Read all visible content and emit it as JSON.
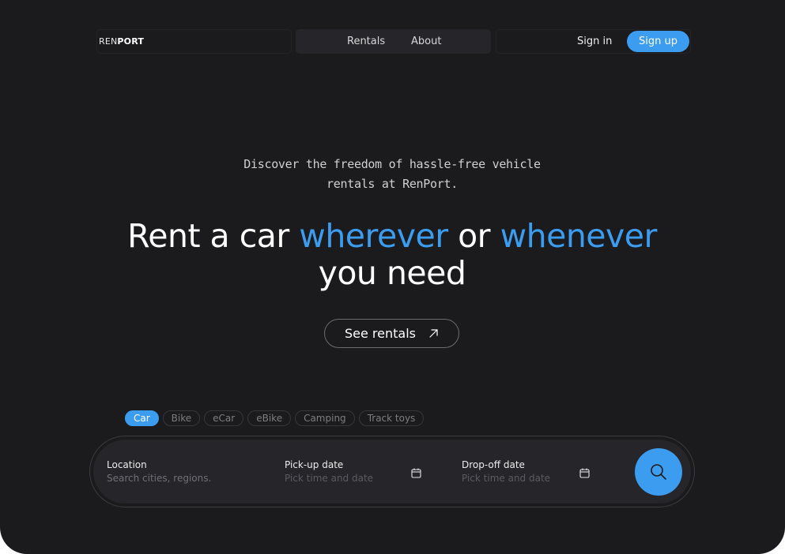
{
  "nav": {
    "logo_prefix": "REN",
    "logo_suffix": "PORT",
    "links": [
      "Rentals",
      "About"
    ],
    "sign_in": "Sign in",
    "sign_up": "Sign up"
  },
  "hero": {
    "tagline_line1": "Discover the freedom of hassle-free vehicle",
    "tagline_line2": "rentals at RenPort.",
    "headline_part1": "Rent a car ",
    "headline_accent1": "wherever",
    "headline_part2": " or ",
    "headline_accent2": "whenever",
    "headline_line2": "you need",
    "cta_label": "See rentals",
    "cta_icon": "arrow-up-right-icon"
  },
  "categories": {
    "items": [
      "Car",
      "Bike",
      "eCar",
      "eBike",
      "Camping",
      "Track toys"
    ],
    "selected": "Car"
  },
  "search": {
    "location_label": "Location",
    "location_placeholder": "Search cities, regions.",
    "pickup_label": "Pick-up date",
    "pickup_placeholder": "Pick time and date",
    "dropoff_label": "Drop-off date",
    "dropoff_placeholder": "Pick time and date",
    "search_icon": "search-icon",
    "calendar_icon": "calendar-icon"
  },
  "colors": {
    "background": "#1b1b1d",
    "accent": "#3b9cf0",
    "panel": "#26262a"
  }
}
